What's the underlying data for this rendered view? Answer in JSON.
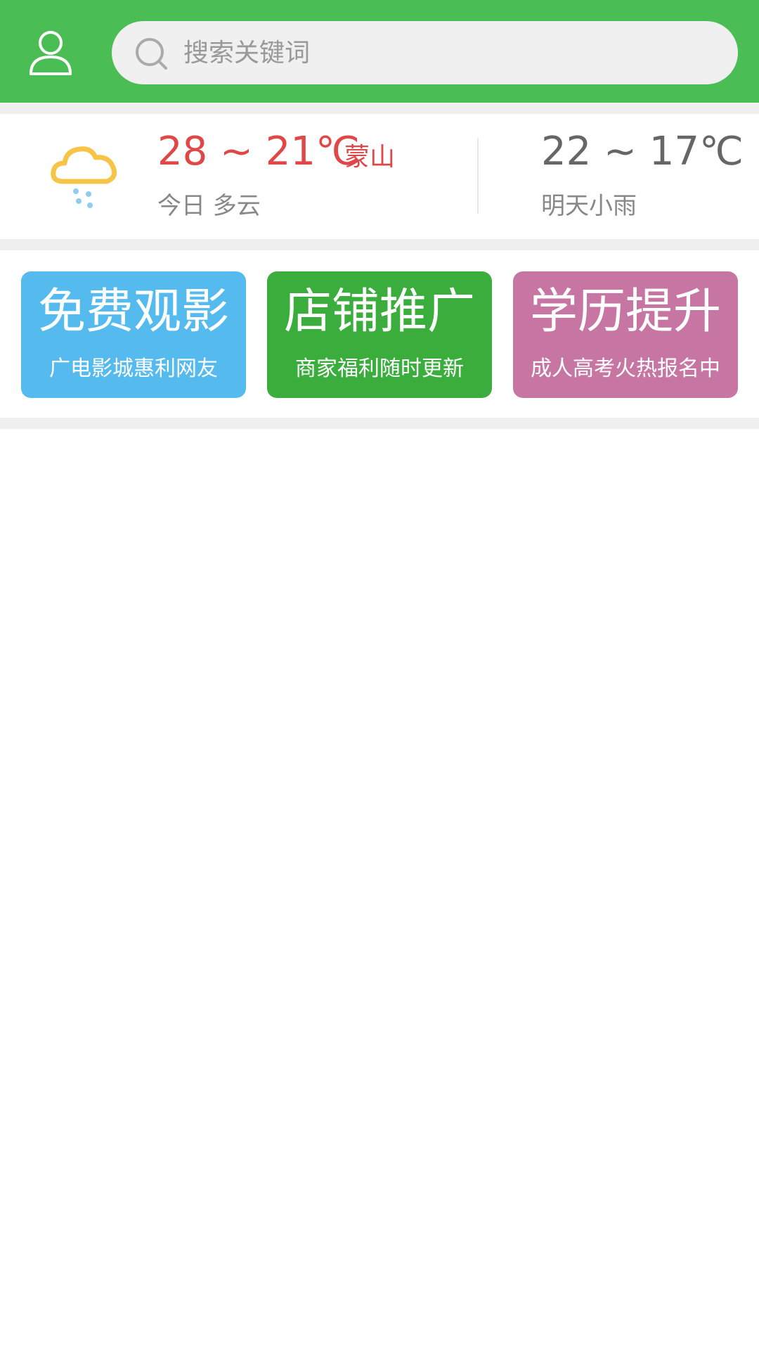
{
  "header": {
    "search_placeholder": "搜索关键词",
    "profile_icon": "user-icon",
    "search_icon": "search-icon",
    "background_color": "#4bbd55"
  },
  "weather": {
    "today_temp": "28 ~ 21℃",
    "city": "蒙山",
    "today_desc": "今日 多云",
    "tomorrow_temp": "22 ~ 17℃",
    "tomorrow_desc": "明天小雨",
    "icon": "cloud-rain-icon",
    "today_color": "#e04848"
  },
  "promos": [
    {
      "title": "免费观影",
      "subtitle": "广电影城惠利网友",
      "color": "#55bbee"
    },
    {
      "title": "店铺推广",
      "subtitle": "商家福利随时更新",
      "color": "#3aad3c"
    },
    {
      "title": "学历提升",
      "subtitle": "成人高考火热报名中",
      "color": "#c776a4"
    }
  ]
}
